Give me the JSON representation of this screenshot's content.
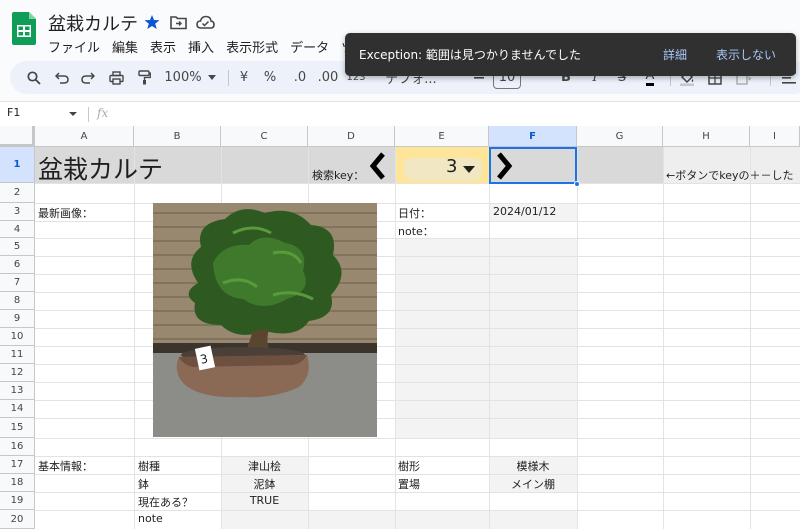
{
  "app": {
    "title": "盆栽カルテ",
    "menu": [
      "ファイル",
      "編集",
      "表示",
      "挿入",
      "表示形式",
      "データ",
      "ツ"
    ]
  },
  "toolbar": {
    "zoom": "100%",
    "currency": "¥",
    "percent": "%",
    "dec_decrease": ".0",
    "dec_increase": ".00",
    "number_format": "123",
    "font": "デフォ...",
    "font_size": "10",
    "bold": "B",
    "italic": "I",
    "strike": "S",
    "text_color": "A"
  },
  "formula_bar": {
    "cell_ref": "F1",
    "fx": "fx"
  },
  "sheet": {
    "columns": [
      "A",
      "B",
      "C",
      "D",
      "E",
      "F",
      "G",
      "H",
      "I"
    ],
    "selected_column": "F",
    "rows": [
      "1",
      "2",
      "3",
      "4",
      "5",
      "6",
      "7",
      "8",
      "9",
      "10",
      "11",
      "12",
      "13",
      "14",
      "15",
      "16",
      "17",
      "18",
      "19",
      "20"
    ],
    "selected_row": "1",
    "cells": {
      "A1": "盆栽カルテ",
      "D1": "検索key：",
      "E1": "3",
      "H1": "←ボタンでkeyの＋－した",
      "A3": "最新画像：",
      "E3": "日付：",
      "F3": "2024/01/12",
      "E4": "note：",
      "A17": "基本情報：",
      "B17": "樹種",
      "C17": "津山桧",
      "E17": "樹形",
      "F17": "模様木",
      "B18": "鉢",
      "C18": "泥鉢",
      "E18": "置場",
      "F18": "メイン棚",
      "B19": "現在ある？",
      "C19": "TRUE",
      "B20": "note"
    },
    "image_tag": "3"
  },
  "toast": {
    "message": "Exception: 範囲は見つかりませんでした",
    "details": "詳細",
    "dismiss": "表示しない"
  },
  "colors": {
    "accent": "#0b57d0",
    "toolbar_bg": "#edf2fa",
    "header_gray": "#d9d9d9",
    "yellow": "#ffe599",
    "cell_gray": "#f3f3f3"
  }
}
